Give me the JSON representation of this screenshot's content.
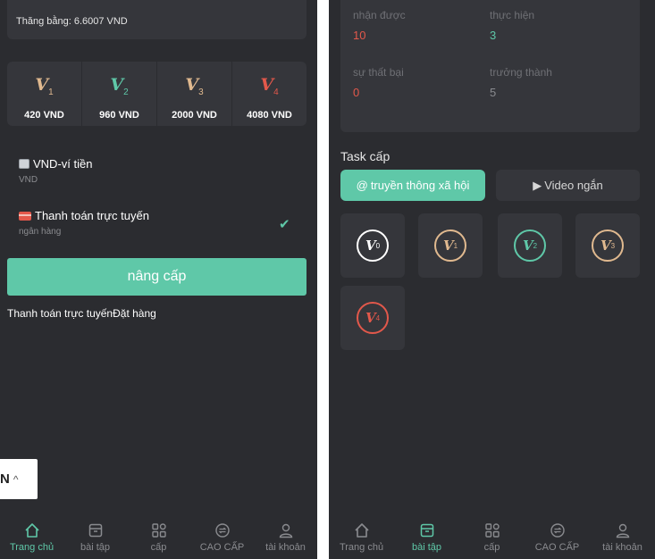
{
  "colors": {
    "accent": "#5fc8a8",
    "background": "#2b2c30",
    "card": "#35363b",
    "value_red": "#e2584b",
    "muted_text": "#8a8b8f"
  },
  "left": {
    "balance_text": "Thăng bằng: 6.6007 VND",
    "levels": [
      {
        "badge": "V",
        "sub": "1",
        "price": "420 VND",
        "color": "#e0b98f"
      },
      {
        "badge": "V",
        "sub": "2",
        "price": "960 VND",
        "color": "#5fc8a8"
      },
      {
        "badge": "V",
        "sub": "3",
        "price": "2000 VND",
        "color": "#e0b98f"
      },
      {
        "badge": "V",
        "sub": "4",
        "price": "4080 VND",
        "color": "#e2584b"
      }
    ],
    "wallet_option": {
      "title": "VND-ví tiền",
      "subtitle": "VND",
      "icon": "wallet-icon"
    },
    "online_option": {
      "title": "Thanh toán trực tuyến",
      "subtitle": "ngân hàng",
      "icon": "card-icon",
      "selected": true
    },
    "upgrade_label": "nâng cấp",
    "order_link": "Thanh toán trực tuyếnĐặt hàng",
    "language": "N",
    "nav": [
      {
        "label": "Trang chủ",
        "icon": "home-icon",
        "active": true
      },
      {
        "label": "bài tập",
        "icon": "task-icon",
        "active": false
      },
      {
        "label": "cấp",
        "icon": "grid-icon",
        "active": false
      },
      {
        "label": "CAO CẤP",
        "icon": "exchange-icon",
        "active": false
      },
      {
        "label": "tài khoản",
        "icon": "user-icon",
        "active": false
      }
    ]
  },
  "right": {
    "stats": [
      {
        "label": "nhận được",
        "value": "10",
        "value_color": "#e2584b"
      },
      {
        "label": "thực hiện",
        "value": "3",
        "value_color": "#5fc8a8"
      },
      {
        "label": "sự thất bại",
        "value": "0",
        "value_color": "#e2584b"
      },
      {
        "label": "trưởng thành",
        "value": "5",
        "value_color": "#8a8b8f"
      }
    ],
    "task_title": "Task cấp",
    "tabs": [
      {
        "label": "truyền thông xã hội",
        "icon": "at-icon",
        "active": true
      },
      {
        "label": "Video ngắn",
        "icon": "play-icon",
        "active": false
      }
    ],
    "levels": [
      {
        "badge": "V",
        "sub": "0",
        "color": "#ffffff"
      },
      {
        "badge": "V",
        "sub": "1",
        "color": "#e0b98f"
      },
      {
        "badge": "V",
        "sub": "2",
        "color": "#5fc8a8"
      },
      {
        "badge": "V",
        "sub": "3",
        "color": "#e0b98f"
      },
      {
        "badge": "V",
        "sub": "4",
        "color": "#e2584b"
      }
    ],
    "nav": [
      {
        "label": "Trang chủ",
        "icon": "home-icon",
        "active": false
      },
      {
        "label": "bài tập",
        "icon": "task-icon",
        "active": true
      },
      {
        "label": "cấp",
        "icon": "grid-icon",
        "active": false
      },
      {
        "label": "CAO CẤP",
        "icon": "exchange-icon",
        "active": false
      },
      {
        "label": "tài khoản",
        "icon": "user-icon",
        "active": false
      }
    ]
  }
}
